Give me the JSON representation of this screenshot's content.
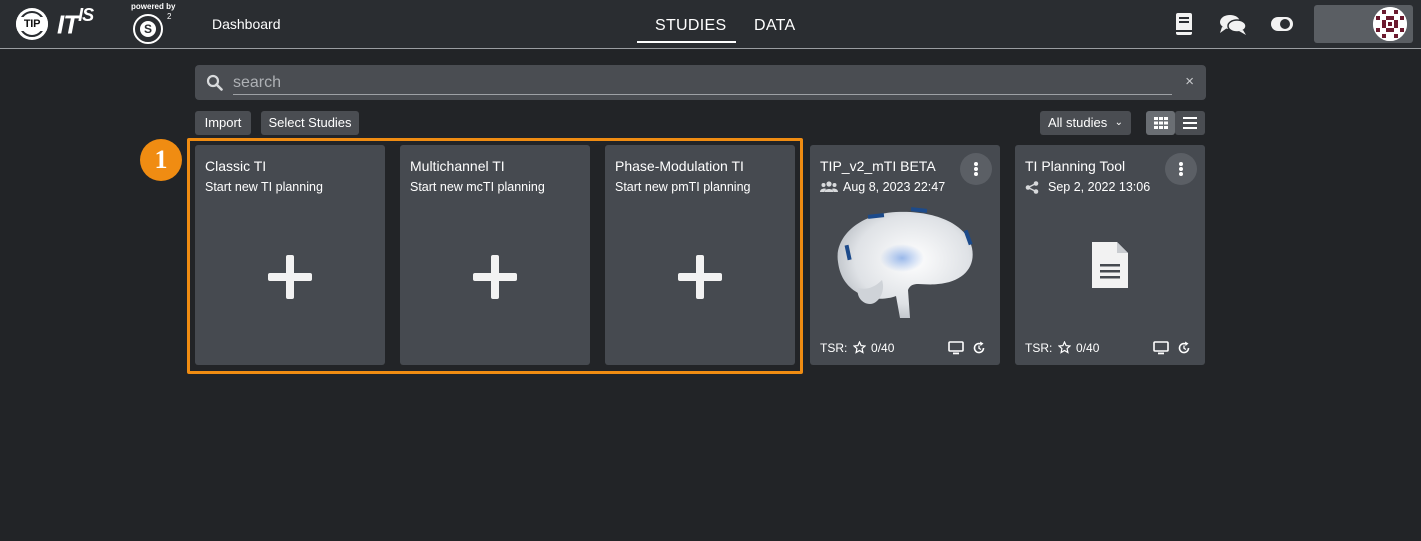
{
  "topbar": {
    "logo_tip": "TIP",
    "logo_itis": "IT",
    "logo_itis_sup": "IS",
    "powered_by": "powered by",
    "s4l_letter": "S",
    "s4l_sup": "2",
    "dashboard": "Dashboard",
    "tabs": [
      {
        "label": "STUDIES",
        "active": true
      },
      {
        "label": "DATA",
        "active": false
      }
    ],
    "icons": [
      "book-icon",
      "chat-icon",
      "toggle-icon"
    ]
  },
  "search": {
    "placeholder": "search",
    "clear": "×"
  },
  "toolbar": {
    "import": "Import",
    "select_studies": "Select Studies",
    "filter": "All studies",
    "filter_chevron": "⌄"
  },
  "step_badge": "1",
  "new_cards": [
    {
      "title": "Classic TI",
      "subtitle": "Start new TI planning"
    },
    {
      "title": "Multichannel TI",
      "subtitle": "Start new mcTI planning"
    },
    {
      "title": "Phase-Modulation TI",
      "subtitle": "Start new pmTI planning"
    }
  ],
  "study_cards": [
    {
      "title": "TIP_v2_mTI BETA",
      "date": "Aug 8, 2023 22:47",
      "tsr_label": "TSR:",
      "tsr_value": "0/40",
      "owner_icon": "users-icon",
      "thumbnail": "brain"
    },
    {
      "title": "TI Planning Tool",
      "date": "Sep 2, 2022 13:06",
      "tsr_label": "TSR:",
      "tsr_value": "0/40",
      "owner_icon": "share-icon",
      "thumbnail": "document"
    }
  ],
  "colors": {
    "background": "#222427",
    "topbar": "#2a2d31",
    "card": "#464a50",
    "highlight": "#f08c12"
  }
}
